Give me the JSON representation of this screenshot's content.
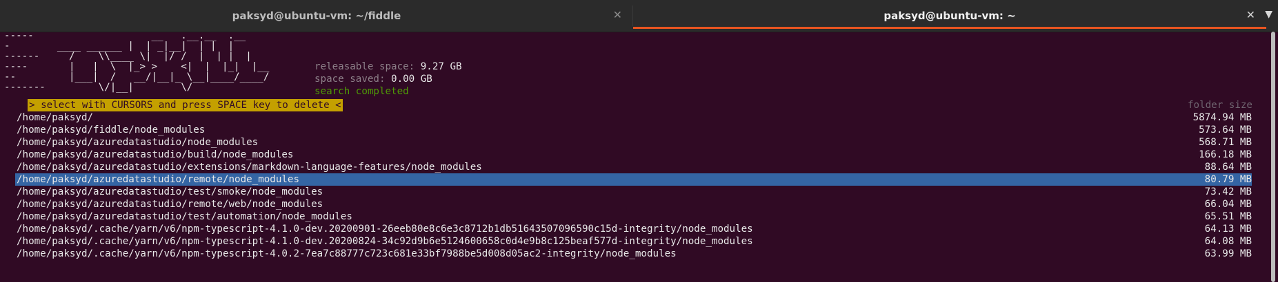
{
  "tabs": [
    {
      "title": "paksyd@ubuntu-vm: ~/fiddle",
      "close_icon": "close-icon"
    },
    {
      "title": "paksyd@ubuntu-vm: ~",
      "close_icon": "close-icon"
    }
  ],
  "logo_lines": [
    "-----                    __   .__.__  .__",
    "-        ____ ______ |  | _|__|  | |  |",
    "------     /    \\\\____ \\|  |/ /  |  | |  |",
    "----       |   |  \\  |_> >    <|  |  |_|  |__",
    "--         |___|  /   __/|__|_ \\__|____/____/",
    "-------         \\/|__|        \\/"
  ],
  "stats": {
    "releasable_label": "releasable space:",
    "releasable_value": "9.27 GB",
    "saved_label": "space saved:",
    "saved_value": "0.00 GB",
    "status": "search completed"
  },
  "banner": "> select with CURSORS and press SPACE key to delete <",
  "column_header": "folder size",
  "rows": [
    {
      "path": "/home/paksyd/",
      "size": "5874.94 MB"
    },
    {
      "path": "/home/paksyd/fiddle/node_modules",
      "size": "573.64 MB"
    },
    {
      "path": "/home/paksyd/azuredatastudio/node_modules",
      "size": "568.71 MB"
    },
    {
      "path": "/home/paksyd/azuredatastudio/build/node_modules",
      "size": "166.18 MB"
    },
    {
      "path": "/home/paksyd/azuredatastudio/extensions/markdown-language-features/node_modules",
      "size": "88.64 MB"
    },
    {
      "path": "/home/paksyd/azuredatastudio/remote/node_modules",
      "size": "80.79 MB",
      "selected": true
    },
    {
      "path": "/home/paksyd/azuredatastudio/test/smoke/node_modules",
      "size": "73.42 MB"
    },
    {
      "path": "/home/paksyd/azuredatastudio/remote/web/node_modules",
      "size": "66.04 MB"
    },
    {
      "path": "/home/paksyd/azuredatastudio/test/automation/node_modules",
      "size": "65.51 MB"
    },
    {
      "path": "/home/paksyd/.cache/yarn/v6/npm-typescript-4.1.0-dev.20200901-26eeb80e8c6e3c8712b1db51643507096590c15d-integrity/node_modules",
      "size": "64.13 MB"
    },
    {
      "path": "/home/paksyd/.cache/yarn/v6/npm-typescript-4.1.0-dev.20200824-34c92d9b6e5124600658c0d4e9b8c125beaf577d-integrity/node_modules",
      "size": "64.08 MB"
    },
    {
      "path": "/home/paksyd/.cache/yarn/v6/npm-typescript-4.0.2-7ea7c88777c723c681e33bf7988be5d008d05ac2-integrity/node_modules",
      "size": "63.99 MB"
    }
  ],
  "colors": {
    "terminal_bg": "#300a24",
    "selection": "#3465a4",
    "banner": "#c4a000",
    "accent": "#e95420",
    "status": "#4e9a06"
  }
}
